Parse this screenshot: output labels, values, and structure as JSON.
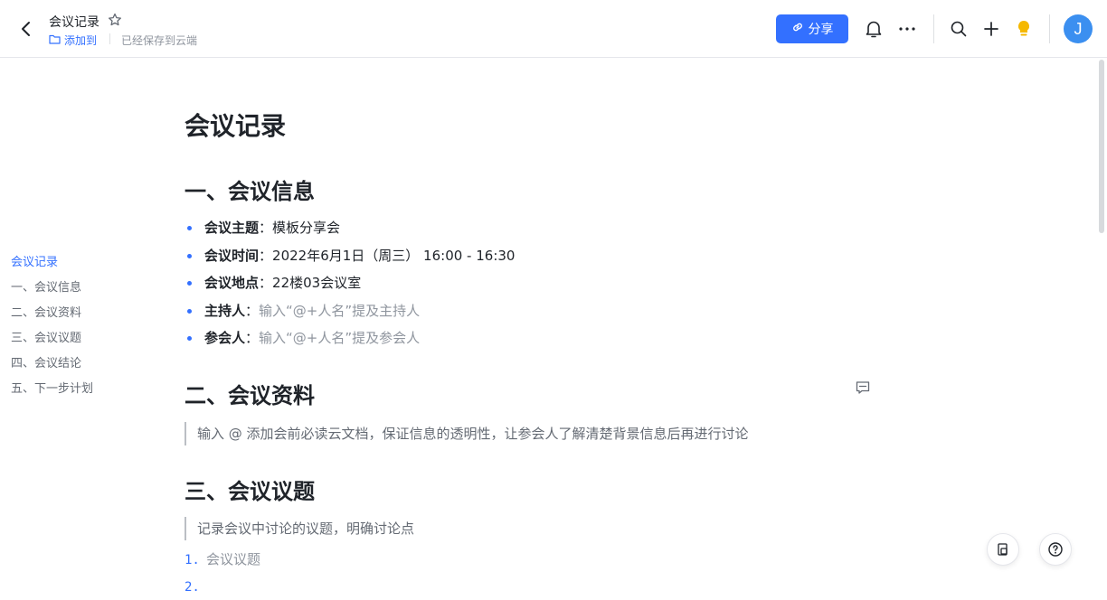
{
  "header": {
    "title": "会议记录",
    "add_to_label": "添加到",
    "saved_status": "已经保存到云端",
    "share_label": "分享",
    "avatar_initial": "J"
  },
  "toc": [
    {
      "label": "会议记录",
      "active": true
    },
    {
      "label": "一、会议信息"
    },
    {
      "label": "二、会议资料"
    },
    {
      "label": "三、会议议题"
    },
    {
      "label": "四、会议结论"
    },
    {
      "label": "五、下一步计划"
    }
  ],
  "doc": {
    "title": "会议记录",
    "section1": {
      "heading": "一、会议信息",
      "items": [
        {
          "label": "会议主题",
          "value": "模板分享会"
        },
        {
          "label": "会议时间",
          "value": "2022年6月1日（周三） 16:00 - 16:30"
        },
        {
          "label": "会议地点",
          "value": "22楼03会议室"
        },
        {
          "label": "主持人",
          "placeholder": "输入“@+人名”提及主持人"
        },
        {
          "label": "参会人",
          "placeholder": "输入“@+人名”提及参会人"
        }
      ]
    },
    "section2": {
      "heading": "二、会议资料",
      "quote": "输入 @ 添加会前必读云文档，保证信息的透明性，让参会人了解清楚背景信息后再进行讨论"
    },
    "section3": {
      "heading": "三、会议议题",
      "quote": "记录会议中讨论的议题，明确讨论点",
      "list": [
        {
          "num": "1.",
          "text": "会议议题"
        },
        {
          "num": "2.",
          "text": ""
        }
      ]
    }
  },
  "colors": {
    "accent": "#3370ff",
    "text": "#1f2329",
    "placeholder": "#8f959e"
  },
  "icons": [
    "back-arrow-icon",
    "star-icon",
    "folder-icon",
    "link-icon",
    "bell-icon",
    "more-icon",
    "search-icon",
    "plus-icon",
    "lightbulb-icon",
    "comment-icon",
    "doc-history-icon",
    "help-icon"
  ]
}
